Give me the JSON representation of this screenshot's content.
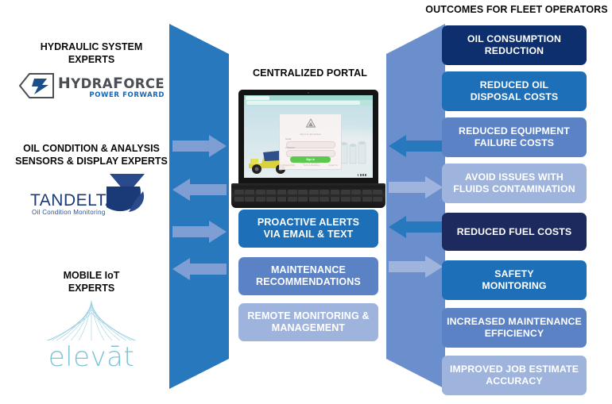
{
  "colors": {
    "navy_dark": "#0d2f6e",
    "navy_darkest": "#1c2a5e",
    "blue_medium": "#1d6fb8",
    "blue_mid": "#5b82c4",
    "blue_light": "#9fb4dd",
    "pillar_left": "#2878be",
    "pillar_right": "#6b8fcc",
    "arrow_light": "#7f9fd4",
    "arrow_dark": "#2878be",
    "heading_text": "#0a0a0a",
    "hydraforce_gray": "#4a4f55",
    "hydraforce_blue": "#1665b0",
    "tandelta_navy": "#1a3a77",
    "elevat_teal": "#7fc3d8",
    "signin_green": "#5bc94d"
  },
  "headings": {
    "outcomes": "OUTCOMES FOR FLEET OPERATORS",
    "portal": "CENTRALIZED PORTAL"
  },
  "partners": [
    {
      "title_line1": "HYDRAULIC SYSTEM",
      "title_line2": "EXPERTS",
      "logo_name": "hydraforce-logo",
      "logo_text": "HydraForce",
      "logo_tagline": "POWER FORWARD"
    },
    {
      "title_line1": "OIL CONDITION & ANALYSIS",
      "title_line2": "SENSORS & DISPLAY EXPERTS",
      "logo_name": "tandelta-logo",
      "logo_text": "TANDELTA",
      "logo_tagline": "Oil Condition Monitoring"
    },
    {
      "title_line1": "MOBILE IoT",
      "title_line2": "EXPERTS",
      "logo_name": "elevat-logo",
      "logo_text": "elevāt",
      "logo_tagline": ""
    }
  ],
  "center_boxes": [
    {
      "line1": "PROACTIVE ALERTS",
      "line2": "VIA EMAIL & TEXT",
      "color": "#1d6fb8"
    },
    {
      "line1": "MAINTENANCE",
      "line2": "RECOMMENDATIONS",
      "color": "#5b82c4"
    },
    {
      "line1": "REMOTE MONITORING &",
      "line2": "MANAGEMENT",
      "color": "#9fb4dd"
    }
  ],
  "outcome_boxes": [
    {
      "line1": "OIL CONSUMPTION",
      "line2": "REDUCTION",
      "color": "#0d2f6e"
    },
    {
      "line1": "REDUCED OIL",
      "line2": "DISPOSAL COSTS",
      "color": "#1d6fb8"
    },
    {
      "line1": "REDUCED EQUIPMENT",
      "line2": "FAILURE COSTS",
      "color": "#5b82c4"
    },
    {
      "line1": "AVOID ISSUES WITH",
      "line2": "FLUIDS CONTAMINATION",
      "color": "#9fb4dd"
    },
    {
      "line1": "REDUCED FUEL COSTS",
      "line2": "",
      "color": "#1c2a5e"
    },
    {
      "line1": "SAFETY",
      "line2": "MONITORING",
      "color": "#1d6fb8"
    },
    {
      "line1": "INCREASED MAINTENANCE",
      "line2": "EFFICIENCY",
      "color": "#5b82c4"
    },
    {
      "line1": "IMPROVED JOB ESTIMATE",
      "line2": "ACCURACY",
      "color": "#9fb4dd"
    }
  ],
  "laptop": {
    "screen_label": "portal-login-screen",
    "signin_button": "Sign In",
    "field_labels": [
      "Email",
      "Password"
    ],
    "forgot_link": "Forgot your password?",
    "footer_links": [
      "Privacy Policy",
      "Terms & Conditions",
      "Contact Us"
    ]
  },
  "arrows": {
    "left_pillar": [
      "right",
      "left",
      "right",
      "left"
    ],
    "right_pillar": [
      "left",
      "right",
      "left",
      "right"
    ]
  }
}
